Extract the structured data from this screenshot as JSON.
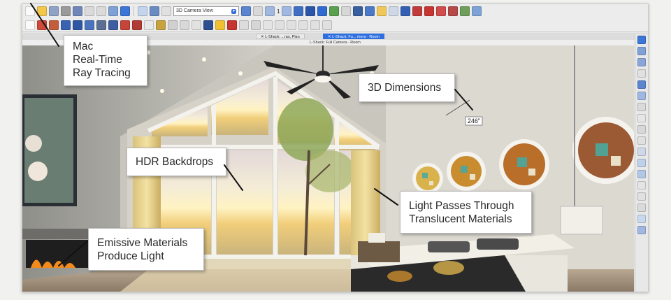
{
  "toolbar": {
    "view_select": "3D Camera View",
    "count": "1"
  },
  "tabs": [
    {
      "label": "L-Shack: ...ras, Plan"
    },
    {
      "label": "L-Shack: Fu... mera - Room"
    }
  ],
  "view_title": "L-Shack: Full Camera - Room",
  "scene": {
    "dimension_label": "246\""
  },
  "callouts": {
    "ray_tracing": [
      "Mac",
      "Real-Time",
      "Ray Tracing"
    ],
    "dimensions": [
      "3D Dimensions"
    ],
    "hdr": [
      "HDR Backdrops"
    ],
    "translucent": [
      "Light Passes Through",
      "Translucent Materials"
    ],
    "emissive": [
      "Emissive Materials",
      "Produce Light"
    ]
  }
}
